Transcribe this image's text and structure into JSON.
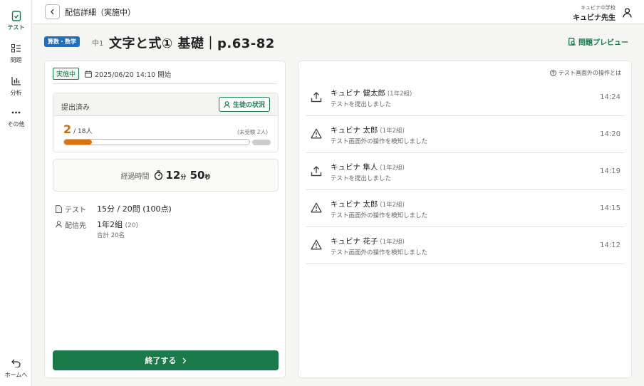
{
  "sidebar": {
    "items": [
      {
        "label": "テスト",
        "icon": "test-icon",
        "active": true
      },
      {
        "label": "問題",
        "icon": "question-list-icon",
        "active": false
      },
      {
        "label": "分析",
        "icon": "chart-icon",
        "active": false
      },
      {
        "label": "その他",
        "icon": "more-icon",
        "active": false
      }
    ],
    "home": {
      "label": "ホームへ",
      "icon": "return-icon"
    }
  },
  "header": {
    "title": "配信詳細（実施中）",
    "school": "キュビナ中学校",
    "teacher": "キュビナ先生"
  },
  "title_row": {
    "subject": "算数・数学",
    "grade": "中1",
    "title": "文字と式① 基礎｜p.63-82",
    "preview": "問題プレビュー"
  },
  "left": {
    "status": "実施中",
    "datetime": "2025/06/20 14:10 開始",
    "submitted_label": "提出済み",
    "student_status_btn": "生徒の状況",
    "submitted_count": "2",
    "total": "/ 18人",
    "unexamined": "(未受験 2人)",
    "progress": 0.15,
    "elapsed_label": "経過時間",
    "elapsed_min": "12",
    "elapsed_min_unit": "分",
    "elapsed_sec": "50",
    "elapsed_sec_unit": "秒",
    "test_label": "テスト",
    "test_value": "15分 / 20問 (100点)",
    "dest_label": "配信先",
    "dest_value": "1年2組",
    "dest_count": "(20)",
    "dest_total": "合計 20名",
    "end_button": "終了する"
  },
  "right": {
    "help": "テスト画面外の操作とは",
    "events": [
      {
        "type": "upload",
        "name": "キュビナ 健太郎",
        "class": "(1年2組)",
        "desc": "テストを提出しました",
        "time": "14:24"
      },
      {
        "type": "warning",
        "name": "キュビナ 太郎",
        "class": "(1年2組)",
        "desc": "テスト画面外の操作を検知しました",
        "time": "14:20"
      },
      {
        "type": "upload",
        "name": "キュビナ 隼人",
        "class": "(1年2組)",
        "desc": "テストを提出しました",
        "time": "14:19"
      },
      {
        "type": "warning",
        "name": "キュビナ 太郎",
        "class": "(1年2組)",
        "desc": "テスト画面外の操作を検知しました",
        "time": "14:15"
      },
      {
        "type": "warning",
        "name": "キュビナ 花子",
        "class": "(1年2組)",
        "desc": "テスト画面外の操作を検知しました",
        "time": "14:12"
      }
    ]
  },
  "colors": {
    "accent": "#1a7a4a",
    "subject": "#1f6fbf",
    "progress": "#d9730d"
  }
}
